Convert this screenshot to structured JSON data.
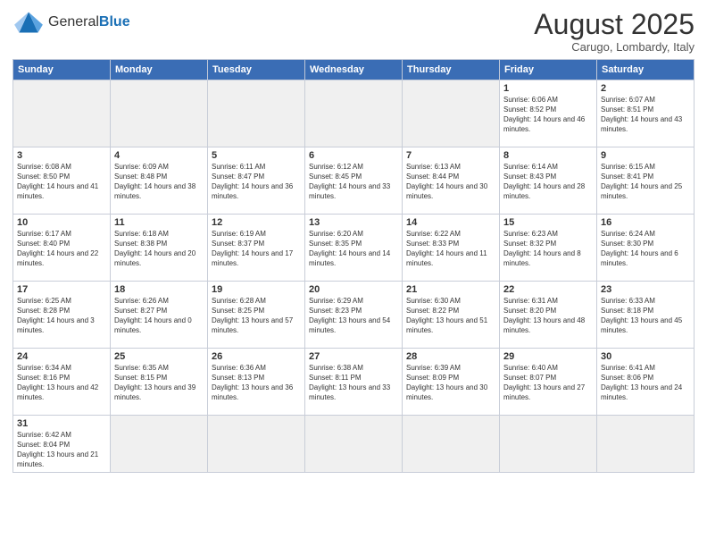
{
  "header": {
    "logo_general": "General",
    "logo_blue": "Blue",
    "month_title": "August 2025",
    "location": "Carugo, Lombardy, Italy"
  },
  "days_of_week": [
    "Sunday",
    "Monday",
    "Tuesday",
    "Wednesday",
    "Thursday",
    "Friday",
    "Saturday"
  ],
  "weeks": [
    [
      {
        "num": "",
        "info": ""
      },
      {
        "num": "",
        "info": ""
      },
      {
        "num": "",
        "info": ""
      },
      {
        "num": "",
        "info": ""
      },
      {
        "num": "",
        "info": ""
      },
      {
        "num": "1",
        "info": "Sunrise: 6:06 AM\nSunset: 8:52 PM\nDaylight: 14 hours and 46 minutes."
      },
      {
        "num": "2",
        "info": "Sunrise: 6:07 AM\nSunset: 8:51 PM\nDaylight: 14 hours and 43 minutes."
      }
    ],
    [
      {
        "num": "3",
        "info": "Sunrise: 6:08 AM\nSunset: 8:50 PM\nDaylight: 14 hours and 41 minutes."
      },
      {
        "num": "4",
        "info": "Sunrise: 6:09 AM\nSunset: 8:48 PM\nDaylight: 14 hours and 38 minutes."
      },
      {
        "num": "5",
        "info": "Sunrise: 6:11 AM\nSunset: 8:47 PM\nDaylight: 14 hours and 36 minutes."
      },
      {
        "num": "6",
        "info": "Sunrise: 6:12 AM\nSunset: 8:45 PM\nDaylight: 14 hours and 33 minutes."
      },
      {
        "num": "7",
        "info": "Sunrise: 6:13 AM\nSunset: 8:44 PM\nDaylight: 14 hours and 30 minutes."
      },
      {
        "num": "8",
        "info": "Sunrise: 6:14 AM\nSunset: 8:43 PM\nDaylight: 14 hours and 28 minutes."
      },
      {
        "num": "9",
        "info": "Sunrise: 6:15 AM\nSunset: 8:41 PM\nDaylight: 14 hours and 25 minutes."
      }
    ],
    [
      {
        "num": "10",
        "info": "Sunrise: 6:17 AM\nSunset: 8:40 PM\nDaylight: 14 hours and 22 minutes."
      },
      {
        "num": "11",
        "info": "Sunrise: 6:18 AM\nSunset: 8:38 PM\nDaylight: 14 hours and 20 minutes."
      },
      {
        "num": "12",
        "info": "Sunrise: 6:19 AM\nSunset: 8:37 PM\nDaylight: 14 hours and 17 minutes."
      },
      {
        "num": "13",
        "info": "Sunrise: 6:20 AM\nSunset: 8:35 PM\nDaylight: 14 hours and 14 minutes."
      },
      {
        "num": "14",
        "info": "Sunrise: 6:22 AM\nSunset: 8:33 PM\nDaylight: 14 hours and 11 minutes."
      },
      {
        "num": "15",
        "info": "Sunrise: 6:23 AM\nSunset: 8:32 PM\nDaylight: 14 hours and 8 minutes."
      },
      {
        "num": "16",
        "info": "Sunrise: 6:24 AM\nSunset: 8:30 PM\nDaylight: 14 hours and 6 minutes."
      }
    ],
    [
      {
        "num": "17",
        "info": "Sunrise: 6:25 AM\nSunset: 8:28 PM\nDaylight: 14 hours and 3 minutes."
      },
      {
        "num": "18",
        "info": "Sunrise: 6:26 AM\nSunset: 8:27 PM\nDaylight: 14 hours and 0 minutes."
      },
      {
        "num": "19",
        "info": "Sunrise: 6:28 AM\nSunset: 8:25 PM\nDaylight: 13 hours and 57 minutes."
      },
      {
        "num": "20",
        "info": "Sunrise: 6:29 AM\nSunset: 8:23 PM\nDaylight: 13 hours and 54 minutes."
      },
      {
        "num": "21",
        "info": "Sunrise: 6:30 AM\nSunset: 8:22 PM\nDaylight: 13 hours and 51 minutes."
      },
      {
        "num": "22",
        "info": "Sunrise: 6:31 AM\nSunset: 8:20 PM\nDaylight: 13 hours and 48 minutes."
      },
      {
        "num": "23",
        "info": "Sunrise: 6:33 AM\nSunset: 8:18 PM\nDaylight: 13 hours and 45 minutes."
      }
    ],
    [
      {
        "num": "24",
        "info": "Sunrise: 6:34 AM\nSunset: 8:16 PM\nDaylight: 13 hours and 42 minutes."
      },
      {
        "num": "25",
        "info": "Sunrise: 6:35 AM\nSunset: 8:15 PM\nDaylight: 13 hours and 39 minutes."
      },
      {
        "num": "26",
        "info": "Sunrise: 6:36 AM\nSunset: 8:13 PM\nDaylight: 13 hours and 36 minutes."
      },
      {
        "num": "27",
        "info": "Sunrise: 6:38 AM\nSunset: 8:11 PM\nDaylight: 13 hours and 33 minutes."
      },
      {
        "num": "28",
        "info": "Sunrise: 6:39 AM\nSunset: 8:09 PM\nDaylight: 13 hours and 30 minutes."
      },
      {
        "num": "29",
        "info": "Sunrise: 6:40 AM\nSunset: 8:07 PM\nDaylight: 13 hours and 27 minutes."
      },
      {
        "num": "30",
        "info": "Sunrise: 6:41 AM\nSunset: 8:06 PM\nDaylight: 13 hours and 24 minutes."
      }
    ],
    [
      {
        "num": "31",
        "info": "Sunrise: 6:42 AM\nSunset: 8:04 PM\nDaylight: 13 hours and 21 minutes."
      },
      {
        "num": "",
        "info": ""
      },
      {
        "num": "",
        "info": ""
      },
      {
        "num": "",
        "info": ""
      },
      {
        "num": "",
        "info": ""
      },
      {
        "num": "",
        "info": ""
      },
      {
        "num": "",
        "info": ""
      }
    ]
  ]
}
